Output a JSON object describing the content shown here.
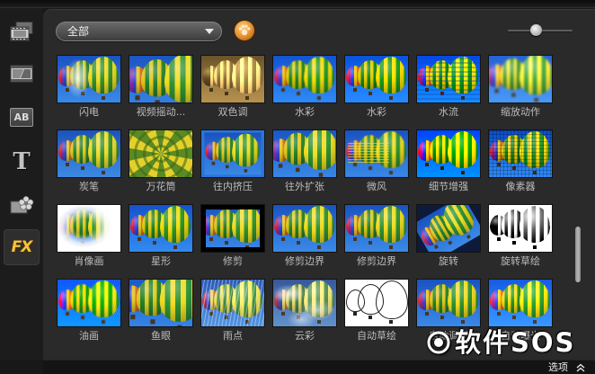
{
  "sidebar": {
    "items": [
      {
        "icon": "media-icon"
      },
      {
        "icon": "transition-icon"
      },
      {
        "icon": "title-icon",
        "glyph": "AB"
      },
      {
        "icon": "text-icon",
        "glyph": "T"
      },
      {
        "icon": "graphic-icon"
      },
      {
        "icon": "fx-icon",
        "glyph": "FX",
        "selected": true
      }
    ]
  },
  "toolbar": {
    "category_dropdown": {
      "selected": "全部",
      "icon": "chevron-down-icon"
    },
    "browse_icon": "browse-library-icon",
    "thumbnail_size_slider": {
      "value": 0.44
    }
  },
  "library": {
    "items": [
      {
        "label": "闪电"
      },
      {
        "label": "视频摇动..."
      },
      {
        "label": "双色调"
      },
      {
        "label": "水彩"
      },
      {
        "label": "水彩"
      },
      {
        "label": "水流"
      },
      {
        "label": "缩放动作"
      },
      {
        "label": "炭笔"
      },
      {
        "label": "万花筒"
      },
      {
        "label": "往内挤压"
      },
      {
        "label": "往外扩张"
      },
      {
        "label": "微风"
      },
      {
        "label": "细节增强"
      },
      {
        "label": "像素器"
      },
      {
        "label": "肖像画"
      },
      {
        "label": "星形"
      },
      {
        "label": "修剪"
      },
      {
        "label": "修剪边界"
      },
      {
        "label": "修剪边界"
      },
      {
        "label": "旋转"
      },
      {
        "label": "旋转草绘"
      },
      {
        "label": "油画"
      },
      {
        "label": "鱼眼"
      },
      {
        "label": "雨点"
      },
      {
        "label": "云彩"
      },
      {
        "label": "自动草绘"
      },
      {
        "label": "自动调配"
      },
      {
        "label": "自动曝光"
      }
    ],
    "scroll_position": 0.7
  },
  "footer": {
    "options_label": "选项",
    "options_icon": "chevron-double-up-icon"
  },
  "watermark": {
    "text": "软件SOS",
    "icon": "watermark-logo-icon"
  },
  "colors": {
    "panel": "#2a2a2a",
    "sidebar": "#1c1c1c",
    "label_text": "#bdbdbd",
    "fx_accent": "#f3c340",
    "browse_icon": "#e38d2c"
  }
}
